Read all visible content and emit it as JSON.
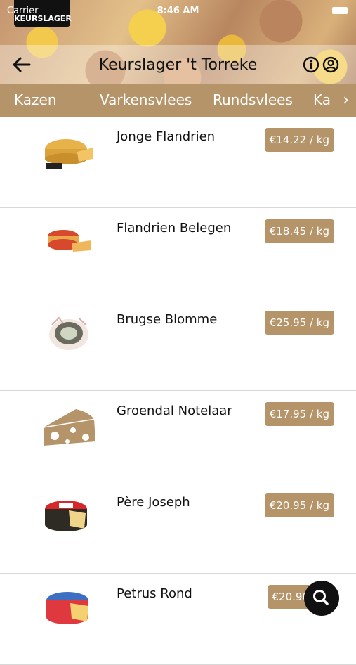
{
  "status": {
    "carrier": "Carrier",
    "time": "8:46 AM"
  },
  "header": {
    "logo_text": "KEURSLAGER",
    "title": "Keurslager 't Torreke"
  },
  "tabs": [
    {
      "label": "Kazen"
    },
    {
      "label": "Varkensvlees"
    },
    {
      "label": "Rundsvlees"
    },
    {
      "label": "Ka"
    }
  ],
  "products": [
    {
      "name": "Jonge Flandrien",
      "price": "€14.22 / kg"
    },
    {
      "name": "Flandrien Belegen",
      "price": "€18.45 / kg"
    },
    {
      "name": "Brugse Blomme",
      "price": "€25.95 / kg"
    },
    {
      "name": "Groendal Notelaar",
      "price": "€17.95 / kg"
    },
    {
      "name": "Père Joseph",
      "price": "€20.95 / kg"
    },
    {
      "name": "Petrus Rond",
      "price": "€20.90"
    }
  ],
  "colors": {
    "accent": "#b5946a",
    "fab": "#111111"
  }
}
